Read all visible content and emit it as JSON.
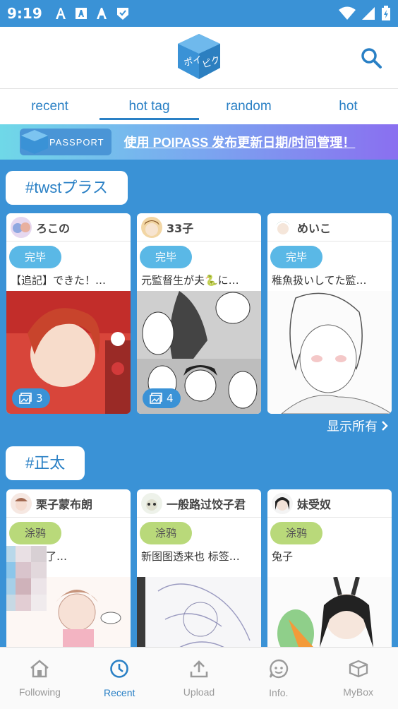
{
  "status": {
    "time": "9:19"
  },
  "tabs": [
    {
      "label": "recent"
    },
    {
      "label": "hot tag"
    },
    {
      "label": "random"
    },
    {
      "label": "hot"
    }
  ],
  "banner": {
    "passport": "PASSPORT",
    "text": "使用 POIPASS 发布更新日期/时间管理！"
  },
  "sections": [
    {
      "tag": "#twstプラス",
      "cards": [
        {
          "user": "ろこの",
          "badge": "完毕",
          "desc": "【追記】できた！…",
          "count": "3"
        },
        {
          "user": "33子",
          "badge": "完毕",
          "desc": "元監督生が夫🐍に…",
          "count": "4"
        },
        {
          "user": "めいこ",
          "badge": "完毕",
          "desc": "稚魚扱いしてた監…"
        }
      ]
    },
    {
      "tag": "#正太",
      "cards": [
        {
          "user": "栗子蒙布朗",
          "badge": "涂鸦",
          "desc": "了…"
        },
        {
          "user": "一般路过饺子君",
          "badge": "涂鸦",
          "desc": "新图图透来也 标签…"
        },
        {
          "user": "妹受奴",
          "badge": "涂鸦",
          "desc": "兔子"
        }
      ]
    }
  ],
  "show_all": "显示所有",
  "bottom_nav": [
    {
      "label": "Following",
      "icon": "home-icon"
    },
    {
      "label": "Recent",
      "icon": "clock-icon"
    },
    {
      "label": "Upload",
      "icon": "upload-icon"
    },
    {
      "label": "Info.",
      "icon": "chat-icon"
    },
    {
      "label": "MyBox",
      "icon": "box-icon"
    }
  ],
  "colors": {
    "primary": "#3a92d6",
    "accent": "#2a80c5",
    "done": "#5ab8e6",
    "doodle": "#b9d97a"
  }
}
